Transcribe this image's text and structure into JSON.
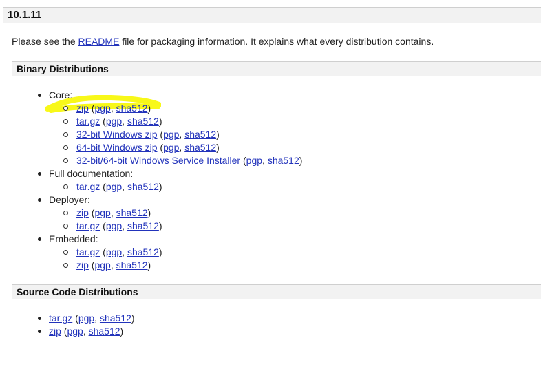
{
  "version": "10.1.11",
  "intro": {
    "before": "Please see the ",
    "link": "README",
    "after": " file for packaging information. It explains what every distribution contains."
  },
  "binary": {
    "title": "Binary Distributions",
    "groups": [
      {
        "label": "Core:",
        "items": [
          {
            "main": "zip",
            "pgp": "pgp",
            "sha": "sha512"
          },
          {
            "main": "tar.gz",
            "pgp": "pgp",
            "sha": "sha512"
          },
          {
            "main": "32-bit Windows zip",
            "pgp": "pgp",
            "sha": "sha512"
          },
          {
            "main": "64-bit Windows zip",
            "pgp": "pgp",
            "sha": "sha512"
          },
          {
            "main": "32-bit/64-bit Windows Service Installer",
            "pgp": "pgp",
            "sha": "sha512"
          }
        ]
      },
      {
        "label": "Full documentation:",
        "items": [
          {
            "main": "tar.gz",
            "pgp": "pgp",
            "sha": "sha512"
          }
        ]
      },
      {
        "label": "Deployer:",
        "items": [
          {
            "main": "zip",
            "pgp": "pgp",
            "sha": "sha512"
          },
          {
            "main": "tar.gz",
            "pgp": "pgp",
            "sha": "sha512"
          }
        ]
      },
      {
        "label": "Embedded:",
        "items": [
          {
            "main": "tar.gz",
            "pgp": "pgp",
            "sha": "sha512"
          },
          {
            "main": "zip",
            "pgp": "pgp",
            "sha": "sha512"
          }
        ]
      }
    ]
  },
  "source": {
    "title": "Source Code Distributions",
    "items": [
      {
        "main": "tar.gz",
        "pgp": "pgp",
        "sha": "sha512"
      },
      {
        "main": "zip",
        "pgp": "pgp",
        "sha": "sha512"
      }
    ]
  },
  "punct": {
    "open": " (",
    "comma": ", ",
    "close": ")"
  },
  "colors": {
    "highlight": "#f7f700",
    "link": "#2233bb"
  }
}
